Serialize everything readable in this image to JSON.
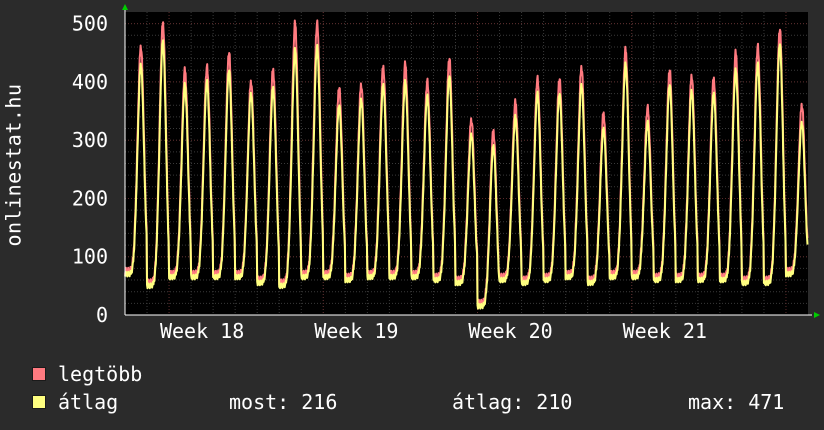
{
  "chart_data": {
    "type": "line",
    "ylabel": "onlinestat.hu",
    "ylim": [
      0,
      520
    ],
    "yticks": [
      0,
      100,
      200,
      300,
      400,
      500
    ],
    "x_tick_labels": [
      "Week 18",
      "Week 19",
      "Week 20",
      "Week 21"
    ],
    "grid": true,
    "days_visible": 31,
    "series": [
      {
        "name": "legtöbb",
        "color": "#ff7a80",
        "daily_peaks": [
          460,
          500,
          420,
          425,
          450,
          400,
          420,
          500,
          500,
          390,
          395,
          425,
          430,
          400,
          440,
          335,
          315,
          365,
          405,
          405,
          425,
          345,
          455,
          355,
          420,
          410,
          405,
          450,
          460,
          490,
          360
        ],
        "daily_mins": [
          75,
          55,
          70,
          70,
          70,
          70,
          60,
          55,
          70,
          70,
          65,
          70,
          70,
          70,
          65,
          60,
          20,
          65,
          60,
          65,
          70,
          60,
          70,
          70,
          65,
          65,
          65,
          65,
          60,
          60,
          75
        ]
      },
      {
        "name": "átlag",
        "color": "#ffff80",
        "daily_peaks": [
          430,
          470,
          395,
          400,
          420,
          380,
          390,
          455,
          460,
          360,
          370,
          395,
          400,
          375,
          410,
          310,
          290,
          340,
          380,
          380,
          395,
          320,
          430,
          330,
          395,
          385,
          380,
          420,
          430,
          465,
          330
        ],
        "daily_mins": [
          70,
          50,
          65,
          65,
          65,
          65,
          55,
          50,
          65,
          65,
          60,
          65,
          65,
          65,
          60,
          55,
          15,
          60,
          55,
          60,
          65,
          55,
          65,
          65,
          60,
          60,
          60,
          60,
          55,
          55,
          70
        ]
      }
    ]
  },
  "legend": {
    "max_label": "legtöbb",
    "avg_label": "átlag",
    "max_color": "#ff7a80",
    "avg_color": "#ffff80"
  },
  "stats": {
    "now": "most: 216",
    "avg": "átlag: 210",
    "max": "max: 471"
  }
}
